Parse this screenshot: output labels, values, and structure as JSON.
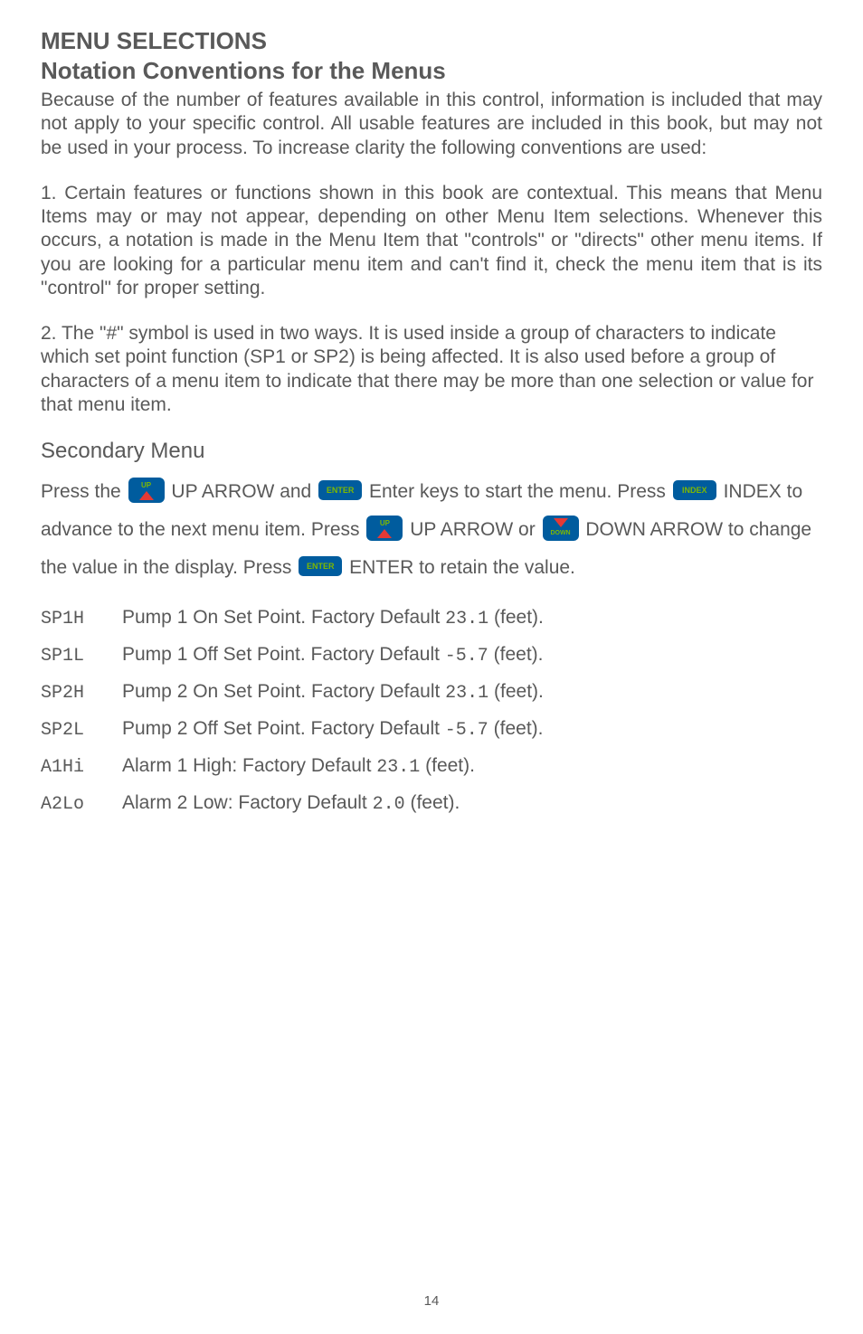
{
  "heading1": "MENU SELECTIONS",
  "heading2": "Notation Conventions for the Menus",
  "para1": "Because of the number of features available in this control, information is included that may not apply to your specific control. All usable features are included in this book, but may not be used in your process. To increase clarity the following conventions are used:",
  "para2": "1. Certain features or functions shown in this book are contextual. This means that Menu Items may or may not appear, depending on other Menu Item selections. Whenever this occurs, a notation is made in the Menu Item that \"controls\" or \"directs\" other menu items. If you are looking for a  particular menu item and can't find it, check the menu item that is its \"control\" for proper setting.",
  "para3": "2. The \"#\" symbol is used in two ways. It is used inside a group of characters to indicate which set point function (SP1 or SP2) is being affected. It is also used before a group of characters of a menu item to indicate that there may be more than one selection or value for that menu item.",
  "heading3": "Secondary Menu",
  "instr": {
    "s1": "Press the",
    "s2": " UP ARROW and",
    "s3": " Enter keys to start the menu. Press ",
    "s4": " INDEX to advance to the next menu item. Press",
    "s5": " UP ARROW or ",
    "s6": " DOWN ARROW to change the value in the display. Press ",
    "s7": " ENTER to retain the value."
  },
  "menu": [
    {
      "code": "SP1H",
      "desc_pre": "Pump 1 On Set Point. Factory Default  ",
      "val": "23.1",
      "desc_post": " (feet)."
    },
    {
      "code": "SP1L",
      "desc_pre": "Pump 1 Off Set Point. Factory Default ",
      "val": "-5.7",
      "desc_post": " (feet)."
    },
    {
      "code": "SP2H",
      "desc_pre": "Pump 2 On Set Point. Factory Default  ",
      "val": "23.1",
      "desc_post": " (feet)."
    },
    {
      "code": "SP2L",
      "desc_pre": "Pump 2 Off Set Point. Factory Default ",
      "val": "-5.7",
      "desc_post": " (feet)."
    },
    {
      "code": "A1Hi",
      "desc_pre": "Alarm 1 High: Factory Default  ",
      "val": "23.1",
      "desc_post": " (feet)."
    },
    {
      "code": "A2Lo",
      "desc_pre": "Alarm 2 Low: Factory Default ",
      "val": "2.0",
      "desc_post": "  (feet)."
    }
  ],
  "page_number": "14"
}
